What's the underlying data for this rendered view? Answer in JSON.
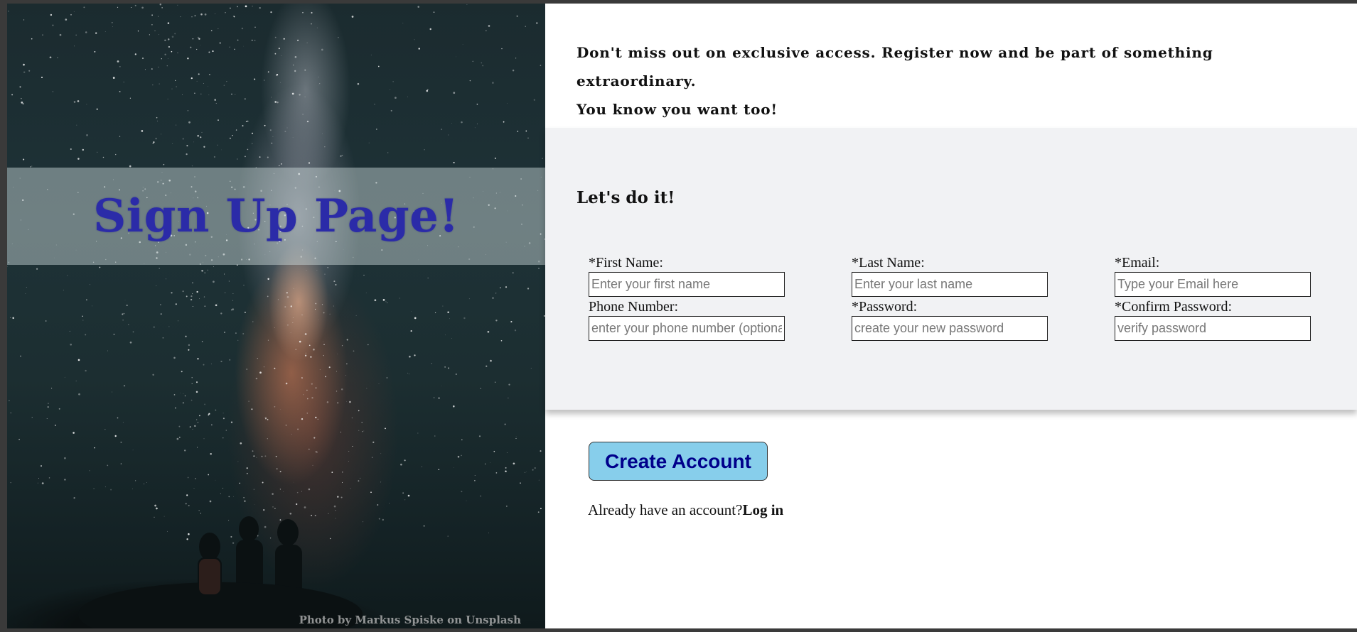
{
  "hero": {
    "title": "Sign Up Page!",
    "photo_credit": "Photo by Markus Spiske on Unsplash"
  },
  "intro": {
    "line1": "Don't miss out on exclusive access. Register now and be part of something extraordinary.",
    "line2": "You know you want too!"
  },
  "form": {
    "title": "Let's do it!",
    "fields": {
      "first_name": {
        "label": "*First Name:",
        "placeholder": "Enter your first name"
      },
      "last_name": {
        "label": "*Last Name:",
        "placeholder": "Enter your last name"
      },
      "email": {
        "label": "*Email:",
        "placeholder": "Type your Email here"
      },
      "phone": {
        "label": "Phone Number:",
        "placeholder": "enter your phone number (optional)"
      },
      "password": {
        "label": "*Password:",
        "placeholder": "create your new password"
      },
      "confirm_password": {
        "label": "*Confirm Password:",
        "placeholder": "verify password"
      }
    },
    "submit_label": "Create Account"
  },
  "login": {
    "prompt": "Already have an account?",
    "link_label": "Log in"
  },
  "colors": {
    "title_color": "#2b2ba8",
    "button_bg": "#87ceeb",
    "button_text": "#00008b",
    "panel_bg": "#f1f2f4"
  }
}
